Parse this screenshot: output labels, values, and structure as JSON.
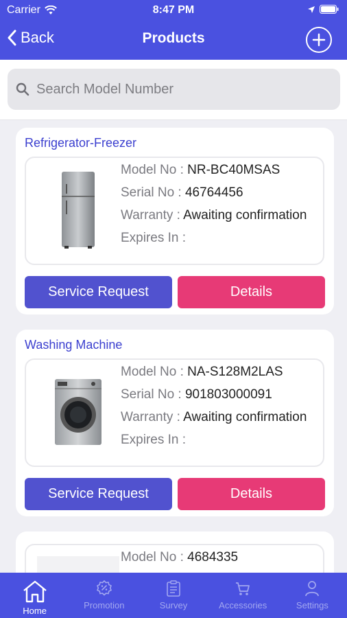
{
  "status_bar": {
    "carrier": "Carrier",
    "time": "8:47 PM"
  },
  "navbar": {
    "back_label": "Back",
    "title": "Products"
  },
  "search": {
    "placeholder": "Search Model Number"
  },
  "products": [
    {
      "category": "Refrigerator-Freezer",
      "model_label": "Model No : ",
      "model": "NR-BC40MSAS",
      "serial_label": "Serial No : ",
      "serial": "46764456",
      "warranty_label": "Warranty : ",
      "warranty": "Awaiting confirmation",
      "expires_label": "Expires In : ",
      "service_label": "Service Request",
      "details_label": "Details"
    },
    {
      "category": "Washing Machine",
      "model_label": "Model No : ",
      "model": "NA-S128M2LAS",
      "serial_label": "Serial No : ",
      "serial": "901803000091",
      "warranty_label": "Warranty : ",
      "warranty": "Awaiting confirmation",
      "expires_label": "Expires In : ",
      "service_label": "Service Request",
      "details_label": "Details"
    },
    {
      "model_label": "Model No : ",
      "model": "4684335"
    }
  ],
  "tabs": [
    {
      "label": "Home",
      "icon": "home-icon",
      "active": true
    },
    {
      "label": "Promotion",
      "icon": "promotion-icon",
      "active": false
    },
    {
      "label": "Survey",
      "icon": "survey-icon",
      "active": false
    },
    {
      "label": "Accessories",
      "icon": "cart-icon",
      "active": false
    },
    {
      "label": "Settings",
      "icon": "user-icon",
      "active": false
    }
  ],
  "colors": {
    "primary": "#4a51e0",
    "service_button": "#5152cf",
    "details_button": "#e73a76",
    "category_text": "#3b3fcf"
  }
}
